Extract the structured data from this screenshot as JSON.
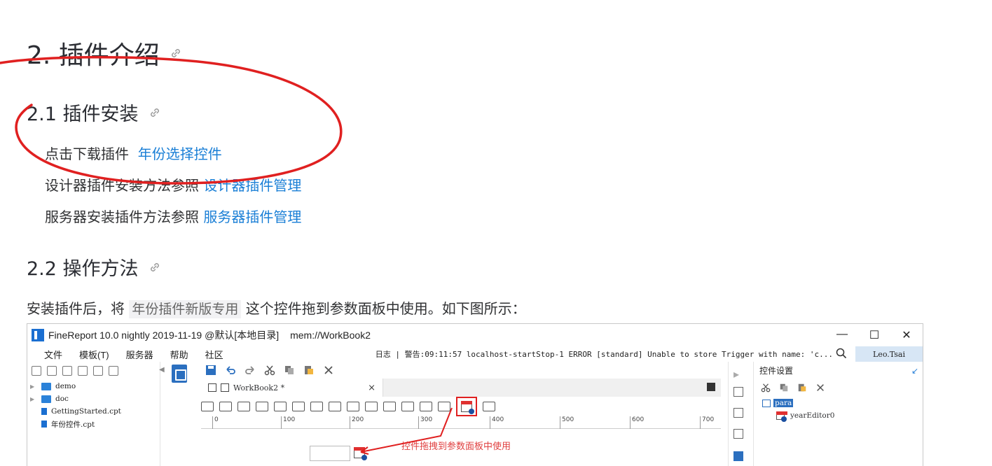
{
  "doc": {
    "h2": "2. 插件介绍",
    "h3_install": "2.1 插件安装",
    "line1_prefix": "点击下载插件",
    "line1_link": "年份选择控件",
    "line2_prefix": "设计器插件安装方法参照",
    "line2_link": "设计器插件管理",
    "line3_prefix": "服务器安装插件方法参照",
    "line3_link": "服务器插件管理",
    "h3_usage": "2.2 操作方法",
    "para_before": "安装插件后，将",
    "para_code": "年份插件新版专用",
    "para_after": "这个控件拖到参数面板中使用。如下图所示："
  },
  "app": {
    "title": "FineReport 10.0 nightly 2019-11-19 @默认[本地目录]",
    "path": "mem://WorkBook2",
    "win_min": "—",
    "win_max": "☐",
    "win_close": "✕",
    "menus": [
      "文件",
      "模板(T)",
      "服务器",
      "帮助",
      "社区"
    ],
    "log": "日志 | 警告:09:11:57 localhost-startStop-1 ERROR [standard] Unable to store Trigger with name: 'c...",
    "user": "Leo.Tsai",
    "tree": [
      {
        "kind": "folder",
        "name": "demo"
      },
      {
        "kind": "folder",
        "name": "doc"
      },
      {
        "kind": "file",
        "name": "GettingStarted.cpt"
      },
      {
        "kind": "file",
        "name": "年份控件.cpt"
      }
    ],
    "tab_label": "WorkBook2 *",
    "tab_close": "×",
    "ruler": [
      "0",
      "100",
      "200",
      "300",
      "400",
      "500",
      "600",
      "700"
    ],
    "drag_note": "控件拖拽到参数面板中使用",
    "right_title": "控件设置",
    "right_tree_root": "para",
    "right_tree_child": "yearEditor0"
  },
  "colors": {
    "link": "#1a7fd6",
    "annotation": "#e02020",
    "accent": "#2b6fbf"
  }
}
